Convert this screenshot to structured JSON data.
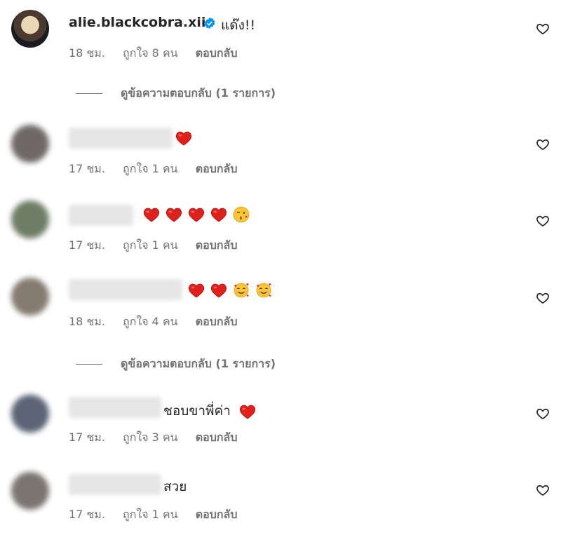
{
  "comments": [
    {
      "username": "alie.blackcobra.xii",
      "text": "แด๊ง!!",
      "time": "18 ชม.",
      "likes": "ถูกใจ 8 คน",
      "reply": "ตอบกลับ"
    },
    {
      "time": "17 ชม.",
      "likes": "ถูกใจ 1 คน",
      "reply": "ตอบกลับ"
    },
    {
      "time": "17 ชม.",
      "likes": "ถูกใจ 1 คน",
      "reply": "ตอบกลับ"
    },
    {
      "time": "18 ชม.",
      "likes": "ถูกใจ 4 คน",
      "reply": "ตอบกลับ"
    },
    {
      "text": "ชอบขาพี่ค่า",
      "time": "17 ชม.",
      "likes": "ถูกใจ 3 คน",
      "reply": "ตอบกลับ"
    },
    {
      "text": "สวย",
      "time": "17 ชม.",
      "likes": "ถูกใจ 1 คน",
      "reply": "ตอบกลับ"
    }
  ],
  "view_replies": "ดูข้อความตอบกลับ (1 รายการ)",
  "icons": {
    "like": "heart-outline-icon",
    "verified": "verified-badge-icon",
    "emoji_heart": "red-heart-emoji",
    "emoji_kiss": "kissing-face-emoji",
    "emoji_love": "smiling-face-with-hearts-emoji"
  },
  "colors": {
    "verified": "#0095f6",
    "emoji_heart": "#e0201b",
    "secondary_text": "#737373"
  }
}
